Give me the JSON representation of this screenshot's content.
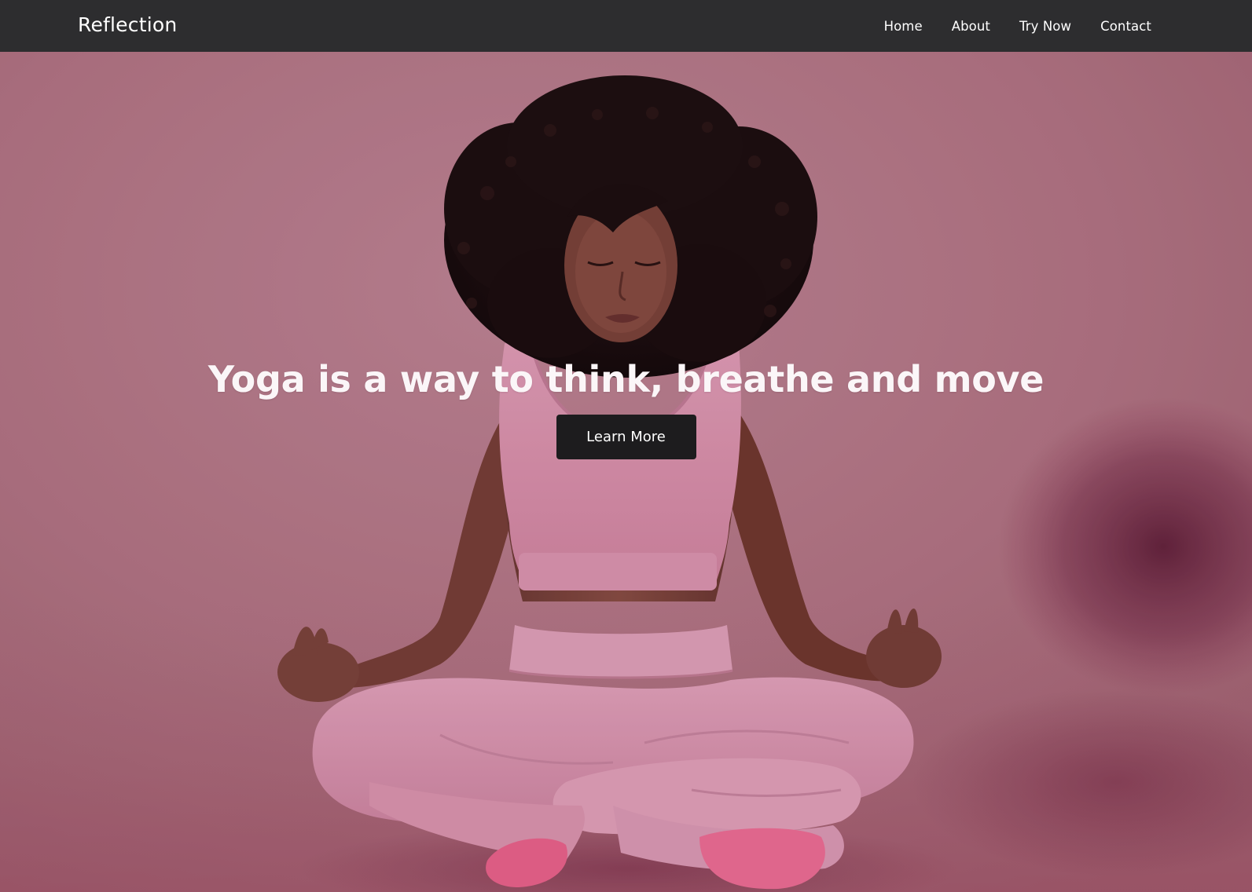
{
  "nav": {
    "brand": "Reflection",
    "links": [
      "Home",
      "About",
      "Try Now",
      "Contact"
    ]
  },
  "hero": {
    "headline": "Yoga is a way to think, breathe and move",
    "cta_label": "Learn More",
    "photo": "woman-meditating-lotus-pose"
  },
  "colors": {
    "navbar": "#2d2d2f",
    "hero_background": "#b87787",
    "button": "#1d1c1e",
    "text": "#ffffff",
    "outfit": "#e89ab6",
    "socks": "#f3678f",
    "hair": "#1f1112"
  }
}
